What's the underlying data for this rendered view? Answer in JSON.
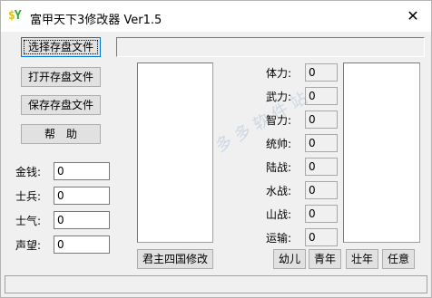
{
  "window": {
    "title": "富甲天下3修改器 Ver1.5",
    "icon_text_dollar": "$",
    "icon_text_yen": "Y",
    "close_glyph": "✕"
  },
  "left_buttons": {
    "select_save": "选择存盘文件",
    "open_save": "打开存盘文件",
    "write_save": "保存存盘文件",
    "help": "帮　助"
  },
  "player_stats": [
    {
      "label": "金钱:",
      "value": "0"
    },
    {
      "label": "士兵:",
      "value": "0"
    },
    {
      "label": "士气:",
      "value": "0"
    },
    {
      "label": "声望:",
      "value": "0"
    }
  ],
  "lord_button": "君主四国修改",
  "general_stats": [
    {
      "label": "体力:",
      "value": "0"
    },
    {
      "label": "武力:",
      "value": "0"
    },
    {
      "label": "智力:",
      "value": "0"
    },
    {
      "label": "统帅:",
      "value": "0"
    },
    {
      "label": "陆战:",
      "value": "0"
    },
    {
      "label": "水战:",
      "value": "0"
    },
    {
      "label": "山战:",
      "value": "0"
    },
    {
      "label": "运输:",
      "value": "0"
    }
  ],
  "age_buttons": [
    "幼儿",
    "青年",
    "壮年",
    "任意"
  ],
  "watermark_text": "多 多 软 件 站",
  "colors": {
    "focus_border": "#0078d7",
    "window_bg": "#f0f0f0"
  }
}
